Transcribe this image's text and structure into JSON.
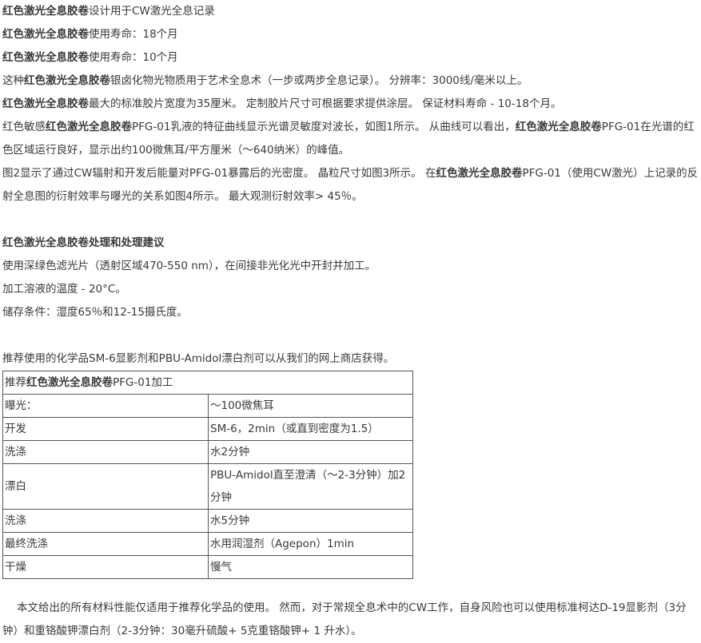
{
  "product": "红色激光全息胶卷",
  "lines": [
    {
      "pre": "",
      "hl": "红色激光全息胶卷",
      "post": "设计用于CW激光全息记录"
    },
    {
      "pre": "",
      "hl": "红色激光全息胶卷",
      "post": "使用寿命：18个月"
    },
    {
      "pre": "",
      "hl": "红色激光全息胶卷",
      "post": "使用寿命：10个月"
    },
    {
      "pre": "这种",
      "hl": "红色激光全息胶卷",
      "post": "银卤化物光物质用于艺术全息术（一步或两步全息记录）。 分辨率：3000线/毫米以上。"
    },
    {
      "pre": "",
      "hl": "红色激光全息胶卷",
      "post": "最大的标准胶片宽度为35厘米。 定制胶片尺寸可根据要求提供涂层。 保证材料寿命 - 10-18个月。"
    }
  ],
  "para1": {
    "a": "红色敏感",
    "b": "红色激光全息胶卷",
    "c": "PFG-01乳液的特征曲线显示光谱灵敏度对波长，如图1所示。 从曲线可以看出，",
    "d": "红色激光全息胶卷",
    "e": "PFG-01在光谱的红色区域运行良好，显示出约100微焦耳/平方厘米（〜640纳米）的峰值。"
  },
  "para2": {
    "a": "图2显示了通过CW辐射和开发后能量对PFG-01暴露后的光密度。 晶粒尺寸如图3所示。 在",
    "b": "红色激光全息胶卷",
    "c": "PFG-01（使用CW激光）上记录的反射全息图的衍射效率与曝光的关系如图4所示。 最大观测衍射效率> 45％。"
  },
  "section": {
    "title": "红色激光全息胶卷处理和处理建议",
    "items": [
      "使用深绿色滤光片（透射区域470-550 nm），在间接非光化光中开封并加工。",
      "加工溶液的温度 - 20°C。",
      "储存条件：湿度65％和12-15摄氏度。"
    ]
  },
  "chemicals_note": "推荐使用的化学品SM-6显影剂和PBU-Amidol漂白剂可以从我们的网上商店获得。",
  "table": {
    "title_pre": "推荐",
    "title_hl": "红色激光全息胶卷",
    "title_post": "PFG-01加工",
    "rows": [
      {
        "step": "曝光：",
        "value": "〜100微焦耳"
      },
      {
        "step": "开发",
        "value": "SM-6，2min（或直到密度为1.5）"
      },
      {
        "step": "洗涤",
        "value": "水2分钟"
      },
      {
        "step": "漂白",
        "value": "PBU-Amidol直至澄清（〜2-3分钟）加2分钟"
      },
      {
        "step": "洗涤",
        "value": "水5分钟"
      },
      {
        "step": "最终洗涤",
        "value": "水用润湿剂（Agepon）1min"
      },
      {
        "step": "干燥",
        "value": "慢气"
      }
    ]
  },
  "footer": "本文给出的所有材料性能仅适用于推荐化学品的使用。 然而，对于常规全息术中的CW工作，自身风险也可以使用标准柯达D-19显影剂（3分钟）和重铬酸钾漂白剂（2-3分钟：30毫升硫酸+ 5克重铬酸钾+ 1 升水）。"
}
